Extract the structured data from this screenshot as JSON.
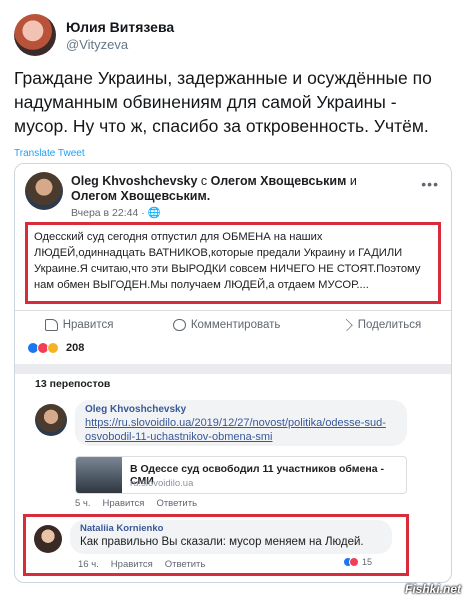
{
  "tweet": {
    "author_name": "Юлия Витязева",
    "author_handle": "@Vityzeva",
    "text": "Граждане Украины, задержанные и осуждённые по надуманным обвинениям для самой Украины - мусор. Ну что ж, спасибо за откровенность. Учтём.",
    "translate_label": "Translate Tweet"
  },
  "fb_post": {
    "header_author": "Oleg Khvoshchevsky",
    "header_with": " с ",
    "header_tag1": "Олегом Хвощевським",
    "header_and": " и ",
    "header_tag2": "Олегом Хвощевським.",
    "time": "Вчера в 22:44 · ",
    "globe": "🌐",
    "more": "•••",
    "body": "Одесский суд сегодня отпустил для ОБМЕНА на наших ЛЮДЕЙ,одиннадцать ВАТНИКОВ,которые предали Украину и ГАДИЛИ Украине.Я считаю,что эти ВЫРОДКИ совсем НИЧЕГО НЕ СТОЯТ.Поэтому нам обмен ВЫГОДЕН.Мы получаем ЛЮДЕЙ,а отдаем МУСОР....",
    "actions": {
      "like": "Нравится",
      "comment": "Комментировать",
      "share": "Поделиться"
    },
    "reactions_count": "208"
  },
  "shares": {
    "title": "13 перепостов",
    "share_item": {
      "name": "Oleg Khvoshchevsky",
      "link": "https://ru.slovoidilo.ua/2019/12/27/novost/politika/odesse-sud-osvobodil-11-uchastnikov-obmena-smi"
    },
    "preview": {
      "title": "В Одессе суд освободил 11 участников обмена - СМИ",
      "site": "ru.slovoidilo.ua"
    },
    "meta": {
      "time": "5 ч.",
      "like": "Нравится",
      "reply": "Ответить"
    }
  },
  "comment": {
    "name": "Nataliia Kornienko",
    "text": "Как правильно Вы сказали: мусор меняем на Людей.",
    "time": "16 ч.",
    "like": "Нравится",
    "reply": "Ответить",
    "reactions_count": "15"
  },
  "watermark": "Fishki.net",
  "colors": {
    "highlight_red": "#d82c3a",
    "fb_blue": "#385898",
    "twitter_blue": "#1da1f2"
  }
}
